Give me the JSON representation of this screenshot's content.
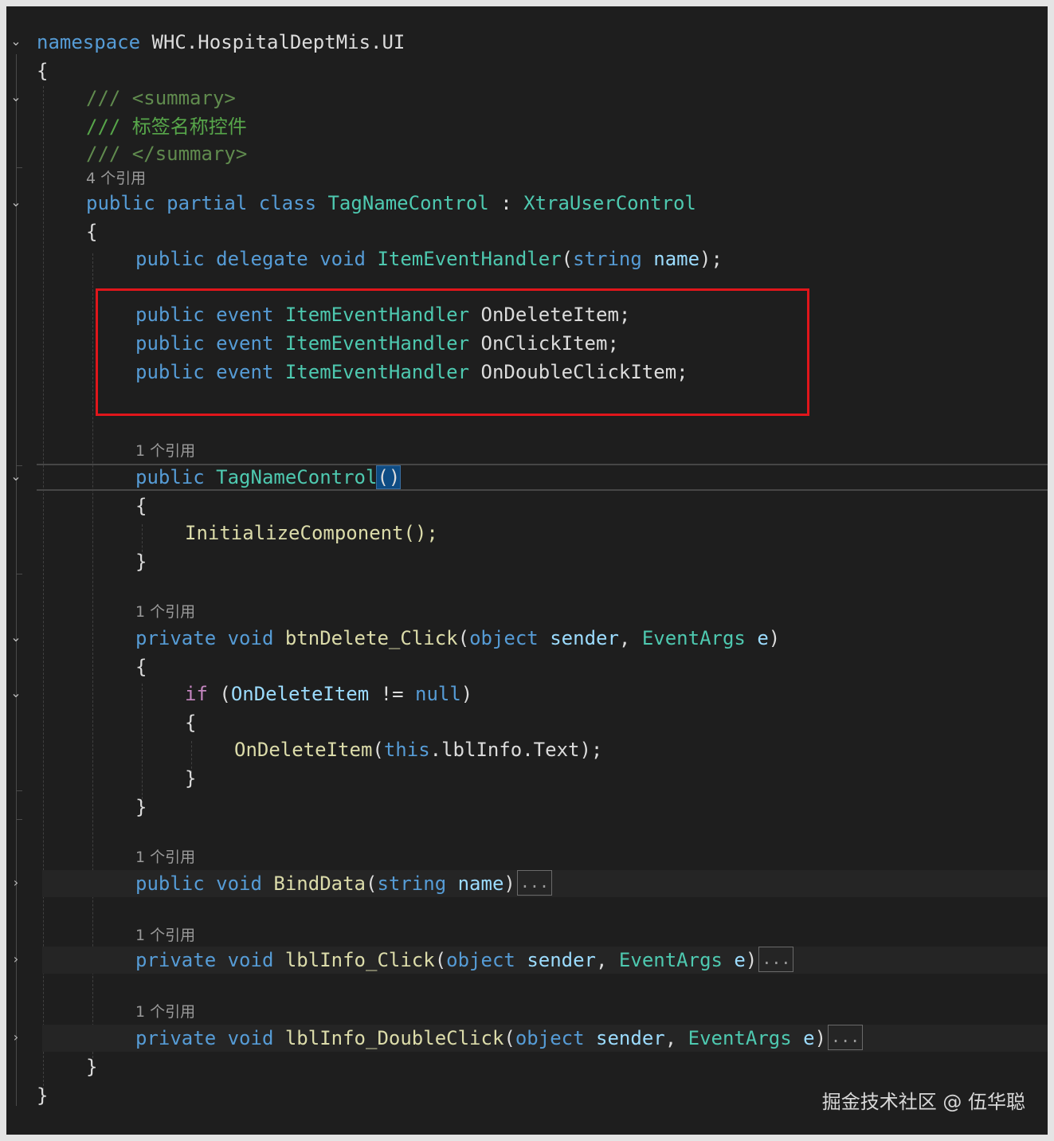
{
  "code": {
    "namespace_kw": "namespace",
    "namespace_name": "WHC.HospitalDeptMis.UI",
    "open_brace": "{",
    "close_brace": "}",
    "summary_open": "/// <summary>",
    "summary_text": "/// 标签名称控件",
    "summary_close": "/// </summary>",
    "lens_class": "4 个引用",
    "class_decl": {
      "kw1": "public",
      "kw2": "partial",
      "kw3": "class",
      "name": "TagNameControl",
      "colon": " : ",
      "base": "XtraUserControl"
    },
    "delegate_decl": {
      "kw1": "public",
      "kw2": "delegate",
      "kw3": "void",
      "name": "ItemEventHandler",
      "open": "(",
      "ptype": "string",
      "pname": "name",
      "close": ");"
    },
    "events": [
      {
        "kw1": "public",
        "kw2": "event",
        "type": "ItemEventHandler",
        "name": "OnDeleteItem;"
      },
      {
        "kw1": "public",
        "kw2": "event",
        "type": "ItemEventHandler",
        "name": "OnClickItem;"
      },
      {
        "kw1": "public",
        "kw2": "event",
        "type": "ItemEventHandler",
        "name": "OnDoubleClickItem;"
      }
    ],
    "lens_ctor": "1 个引用",
    "ctor_decl": {
      "kw": "public",
      "name": "TagNameControl",
      "parens": "()"
    },
    "init_call": "InitializeComponent();",
    "lens_btn": "1 个引用",
    "btn_decl": {
      "kw1": "private",
      "kw2": "void",
      "name": "btnDelete_Click",
      "open": "(",
      "t1": "object",
      "p1": "sender",
      "comma": ", ",
      "t2": "EventArgs",
      "p2": "e",
      "close": ")"
    },
    "if_stmt": {
      "kw": "if",
      "open": " (",
      "cond": "OnDeleteItem",
      "op": " != ",
      "null_kw": "null",
      "close": ")"
    },
    "invoke": {
      "name": "OnDeleteItem",
      "open": "(",
      "this_kw": "this",
      "rest": ".lblInfo.Text);"
    },
    "lens_bind": "1 个引用",
    "bind_decl": {
      "kw1": "public",
      "kw2": "void",
      "name": "BindData",
      "open": "(",
      "t1": "string",
      "p1": "name",
      "close": ")",
      "ellipsis": "..."
    },
    "lens_click": "1 个引用",
    "click_decl": {
      "kw1": "private",
      "kw2": "void",
      "name": "lblInfo_Click",
      "open": "(",
      "t1": "object",
      "p1": "sender",
      "comma": ", ",
      "t2": "EventArgs",
      "p2": "e",
      "close": ")",
      "ellipsis": "..."
    },
    "lens_dbl": "1 个引用",
    "dbl_decl": {
      "kw1": "private",
      "kw2": "void",
      "name": "lblInfo_DoubleClick",
      "open": "(",
      "t1": "object",
      "p1": "sender",
      "comma": ", ",
      "t2": "EventArgs",
      "p2": "e",
      "close": ")",
      "ellipsis": "..."
    }
  },
  "fold_icons": {
    "expanded": "⌄",
    "collapsed": "›"
  },
  "watermark": "掘金技术社区 @ 伍华聪",
  "colors": {
    "highlight_box": "#e0161b",
    "background": "#1e1e1e"
  }
}
